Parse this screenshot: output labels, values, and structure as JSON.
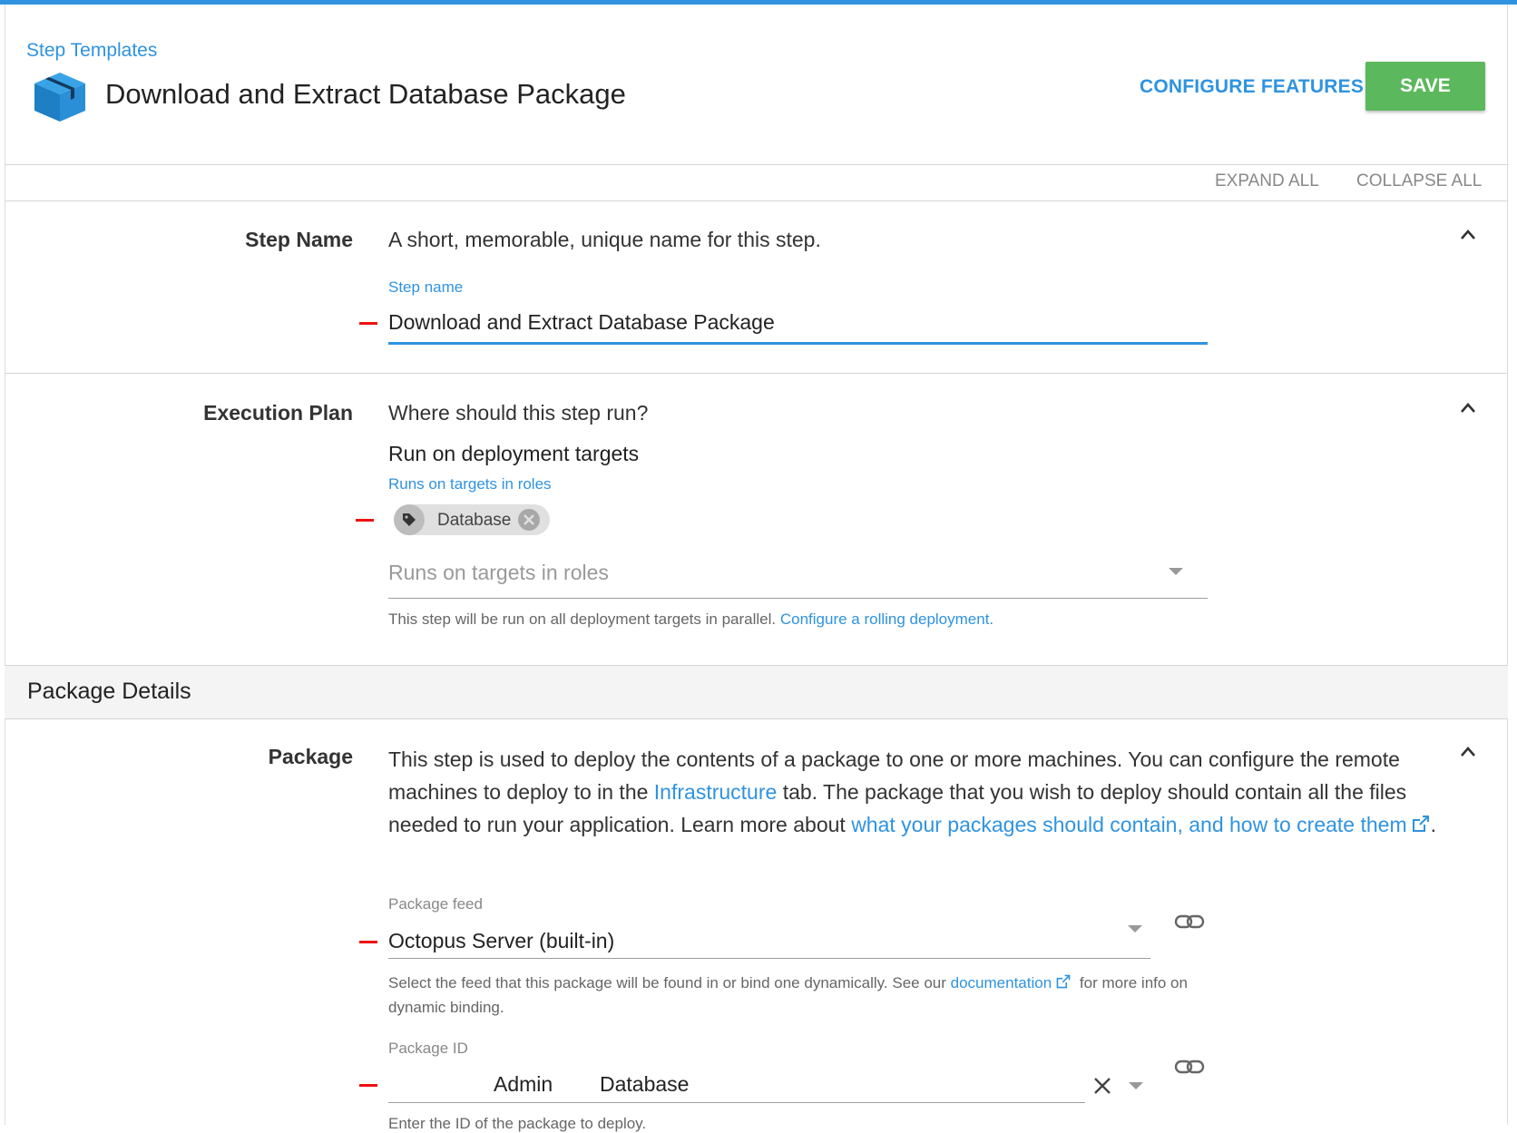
{
  "header": {
    "breadcrumb": "Step Templates",
    "title": "Download and Extract Database Package",
    "configure_features": "CONFIGURE FEATURES",
    "save": "SAVE"
  },
  "toolbar": {
    "expand_all": "EXPAND ALL",
    "collapse_all": "COLLAPSE ALL"
  },
  "step_name": {
    "label": "Step Name",
    "description": "A short, memorable, unique name for this step.",
    "field_label": "Step name",
    "value": "Download and Extract Database Package"
  },
  "execution_plan": {
    "label": "Execution Plan",
    "question": "Where should this step run?",
    "mode": "Run on deployment targets",
    "roles_label": "Runs on targets in roles",
    "chip": "Database",
    "roles_placeholder": "Runs on targets in roles",
    "helper": "This step will be run on all deployment targets in parallel.",
    "helper_link": "Configure a rolling deployment."
  },
  "package_details": {
    "heading": "Package Details",
    "label": "Package",
    "para_1": "This step is used to deploy the contents of a package to one or more machines. You can configure the remote machines to deploy to in the",
    "para_link_1": "Infrastructure",
    "para_2": "tab. The package that you wish to deploy should contain all the files needed to run your application. Learn more about",
    "para_link_2": "what your packages should contain, and how to create them",
    "para_end": ".",
    "feed_label": "Package feed",
    "feed_value": "Octopus Server (built-in)",
    "feed_helper_1": "Select the feed that this package will be found in or bind one dynamically. See our",
    "feed_helper_link": "documentation",
    "feed_helper_2": "for more info on dynamic binding.",
    "id_label": "Package ID",
    "id_value_1": "Admin",
    "id_value_2": "Database",
    "id_helper": "Enter the ID of the package to deploy."
  },
  "icons": [
    "box-icon",
    "chevron-up-icon",
    "tag-icon",
    "remove-chip-icon",
    "dropdown-arrow-icon",
    "external-link-icon",
    "link-icon",
    "clear-icon"
  ],
  "colors": {
    "accent": "#2f93e0",
    "save": "#5cb85c",
    "marker": "#ee1111"
  }
}
